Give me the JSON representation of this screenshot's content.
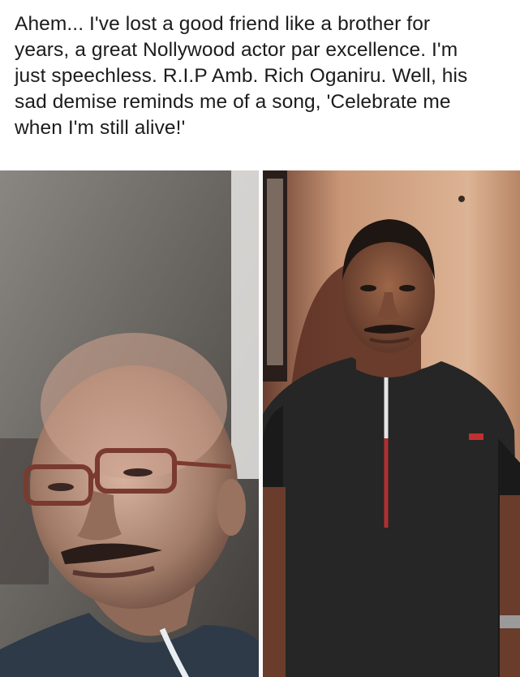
{
  "post": {
    "lines": [
      "Ahem... I've lost a good friend like a brother for",
      "years, a great Nollywood actor par excellence. I'm",
      "just speechless. R.I.P Amb. Rich Oganiru. Well, his",
      "sad demise reminds me of a song, 'Celebrate me",
      "when I'm still alive!'"
    ]
  },
  "gallery": {
    "photos": [
      {
        "subject": "selfie-portrait"
      },
      {
        "subject": "standing-portrait"
      }
    ]
  },
  "colors": {
    "text": "#1c1c1c",
    "divider": "#fafafa"
  }
}
